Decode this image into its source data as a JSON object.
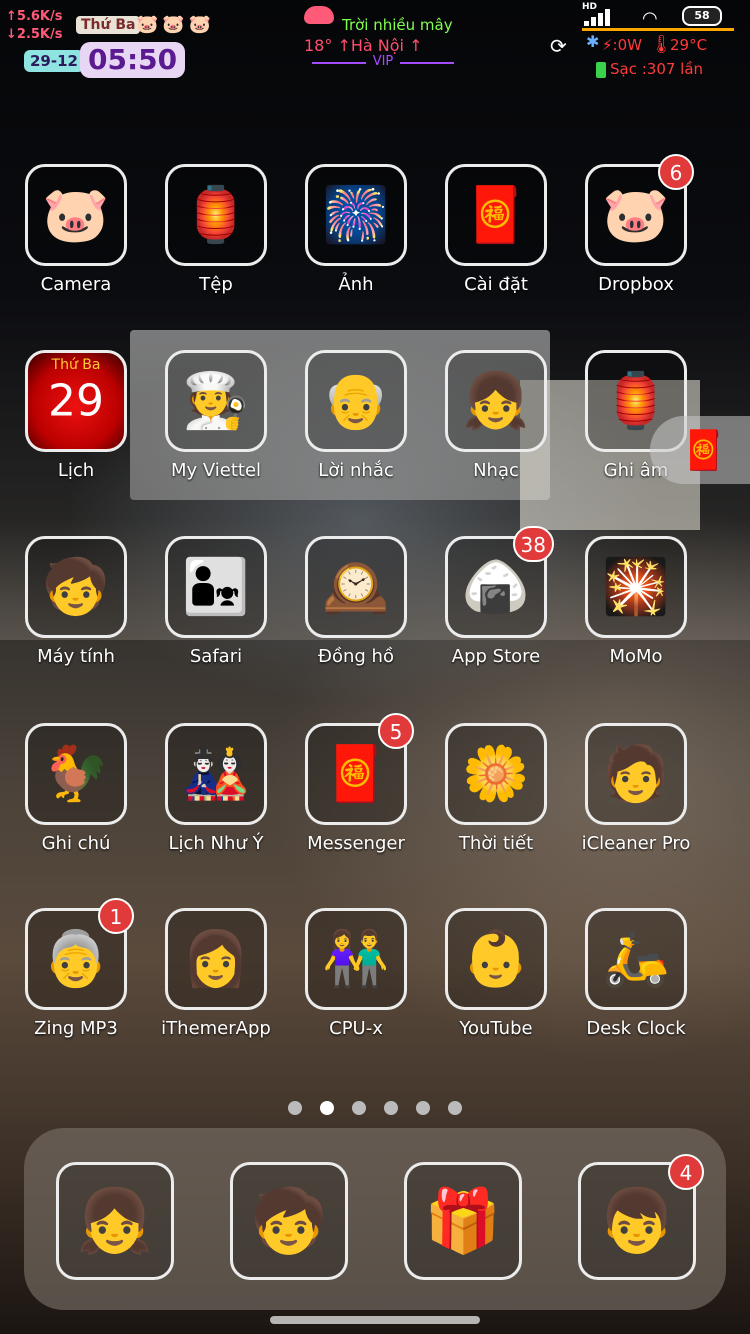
{
  "status": {
    "net_up": "↑5.6K/s",
    "net_down": "↓2.5K/s",
    "weekday": "Thứ Ba",
    "mini_icons": "🐷🐷🐷",
    "date": "29-12",
    "time": "05:50",
    "weather": "Trời nhiều mây",
    "temperature_location": "18° ↑Hà Nội ↑",
    "vip": "VIP",
    "network_type": "HD",
    "wifi_icon": "wifi-icon",
    "battery": "58",
    "power": ":0W",
    "device_temp": "29°C",
    "charge_count": "Sạc    :307 lần",
    "accent": "#ffa500"
  },
  "apps": [
    {
      "label": "Camera",
      "art": "🐷"
    },
    {
      "label": "Tệp",
      "art": "🏮"
    },
    {
      "label": "Ảnh",
      "art": "🎆"
    },
    {
      "label": "Cài đặt",
      "art": "🧧"
    },
    {
      "label": "Dropbox",
      "art": "🐷",
      "badge": "6"
    },
    {
      "label": "Lịch",
      "art": "29",
      "sub": "Thứ Ba"
    },
    {
      "label": "My Viettel",
      "art": "🧑‍🍳"
    },
    {
      "label": "Lời nhắc",
      "art": "👴"
    },
    {
      "label": "Nhạc",
      "art": "👧"
    },
    {
      "label": "Ghi âm",
      "art": "🏮"
    },
    {
      "label": "Máy tính",
      "art": "🧒"
    },
    {
      "label": "Safari",
      "art": "👨‍👧"
    },
    {
      "label": "Đồng hồ",
      "art": "🕰️"
    },
    {
      "label": "App Store",
      "art": "🍙",
      "badge": "38"
    },
    {
      "label": "MoMo",
      "art": "🎇"
    },
    {
      "label": "Ghi chú",
      "art": "🐓"
    },
    {
      "label": "Lịch Như Ý",
      "art": "🎎"
    },
    {
      "label": "Messenger",
      "art": "🧧",
      "badge": "5"
    },
    {
      "label": "Thời tiết",
      "art": "🌼"
    },
    {
      "label": "iCleaner Pro",
      "art": "🧑"
    },
    {
      "label": "Zing MP3",
      "art": "👵",
      "badge": "1"
    },
    {
      "label": "iThemerApp",
      "art": "👩"
    },
    {
      "label": "CPU-x",
      "art": "👫"
    },
    {
      "label": "YouTube",
      "art": "👶"
    },
    {
      "label": "Desk Clock",
      "art": "🛵"
    }
  ],
  "dock": [
    {
      "name": "dock-app-1",
      "art": "👧"
    },
    {
      "name": "dock-app-2",
      "art": "🧒"
    },
    {
      "name": "dock-app-3",
      "art": "🎁"
    },
    {
      "name": "dock-app-4",
      "art": "👦",
      "badge": "4"
    }
  ],
  "floating_tab_art": "🧧",
  "page_dots": {
    "count": 6,
    "active": 2
  }
}
